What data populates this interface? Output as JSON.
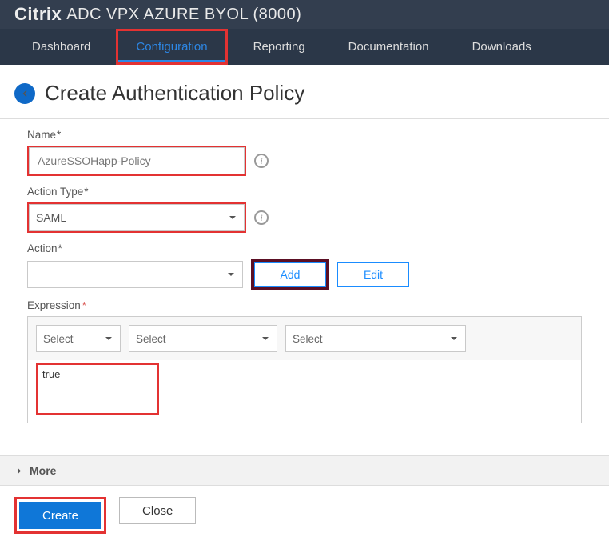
{
  "header": {
    "brand_bold": "Citrix",
    "brand_rest": "ADC VPX AZURE BYOL (8000)"
  },
  "nav": {
    "tabs": [
      {
        "label": "Dashboard"
      },
      {
        "label": "Configuration"
      },
      {
        "label": "Reporting"
      },
      {
        "label": "Documentation"
      },
      {
        "label": "Downloads"
      }
    ]
  },
  "page_title": "Create Authentication Policy",
  "form": {
    "name_label": "Name",
    "name_value": "AzureSSOHapp-Policy",
    "action_type_label": "Action Type",
    "action_type_value": "SAML",
    "action_label": "Action",
    "action_value": "",
    "add_btn": "Add",
    "edit_btn": "Edit",
    "expression_label": "Expression",
    "select_placeholder": "Select",
    "expression_value": "true"
  },
  "more_label": "More",
  "footer": {
    "create": "Create",
    "close": "Close"
  }
}
